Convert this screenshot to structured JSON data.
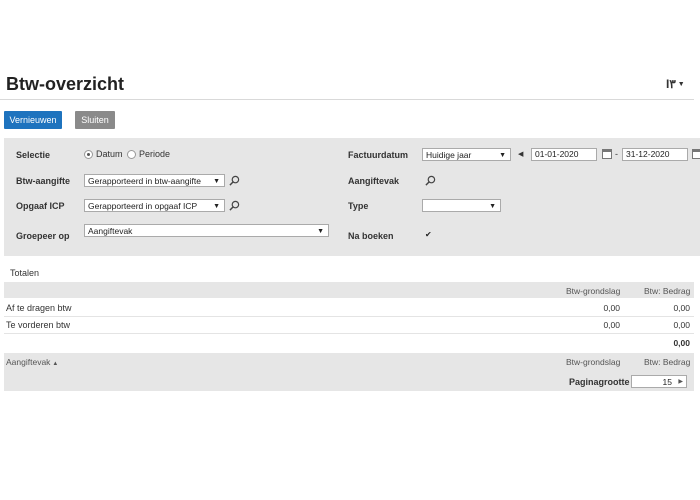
{
  "page": {
    "title": "Btw-overzicht",
    "settings_label": "I٣"
  },
  "toolbar": {
    "refresh_label": "Vernieuwen",
    "close_label": "Sluiten"
  },
  "filters": {
    "selectie_label": "Selectie",
    "datum_label": "Datum",
    "periode_label": "Periode",
    "btw_aangifte_label": "Btw-aangifte",
    "btw_aangifte_value": "Gerapporteerd in btw-aangifte",
    "opgaaf_icp_label": "Opgaaf ICP",
    "opgaaf_icp_value": "Gerapporteerd in opgaaf ICP",
    "groepeer_label": "Groepeer op",
    "groepeer_value": "Aangiftevak",
    "factuurdatum_label": "Factuurdatum",
    "factuurdatum_value": "Huidige jaar",
    "date_from": "01-01-2020",
    "date_sep": "-",
    "date_to": "31-12-2020",
    "aangiftevak_label": "Aangiftevak",
    "type_label": "Type",
    "type_value": "",
    "na_boeken_label": "Na boeken",
    "na_boeken_checked": true
  },
  "totals": {
    "section_label": "Totalen",
    "col_grondslag": "Btw-grondslag",
    "col_bedrag": "Btw: Bedrag",
    "rows": [
      {
        "label": "Af te dragen btw",
        "grondslag": "0,00",
        "bedrag": "0,00"
      },
      {
        "label": "Te vorderen btw",
        "grondslag": "0,00",
        "bedrag": "0,00"
      }
    ],
    "sum": "0,00"
  },
  "detail": {
    "col_aangiftevak": "Aangiftevak",
    "sort_indicator": "▲",
    "col_grondslag": "Btw-grondslag",
    "col_bedrag": "Btw: Bedrag",
    "page_size_label": "Paginagrootte",
    "page_size_value": "15"
  },
  "colors": {
    "primary": "#1e73be",
    "secondary": "#8a8a8a",
    "panel": "#e6e6e6"
  }
}
